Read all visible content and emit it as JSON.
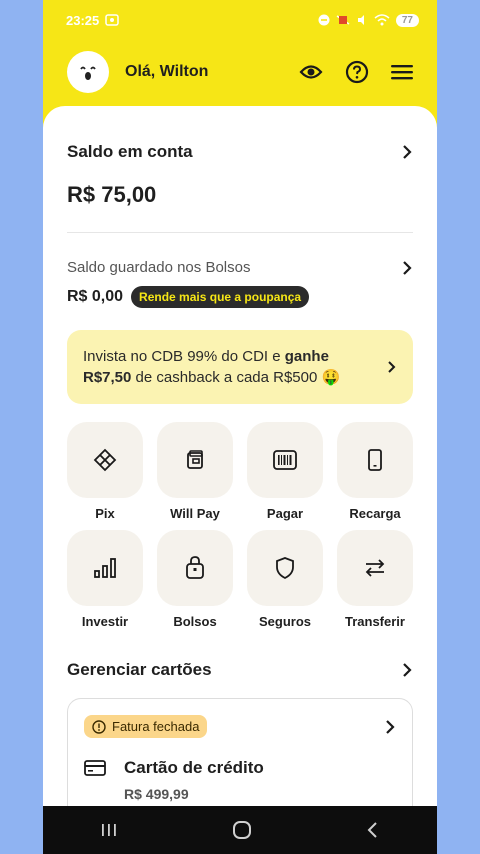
{
  "status": {
    "time": "23:25",
    "battery": "77"
  },
  "header": {
    "greeting": "Olá, Wilton"
  },
  "saldo": {
    "title": "Saldo em conta",
    "value": "R$ 75,00"
  },
  "bolsos": {
    "title": "Saldo guardado nos Bolsos",
    "value": "R$ 0,00",
    "badge": "Rende mais que a poupança"
  },
  "promo": {
    "text_1": "Invista no CDB 99% do CDI e ",
    "text_bold_1": "ganhe",
    "text_bold_2": "R$7,50",
    "text_2": " de cashback a cada R$500 🤑"
  },
  "shortcuts": [
    {
      "label": "Pix",
      "icon": "pix-icon"
    },
    {
      "label": "Will Pay",
      "icon": "wallet-icon"
    },
    {
      "label": "Pagar",
      "icon": "barcode-icon"
    },
    {
      "label": "Recarga",
      "icon": "phone-icon"
    },
    {
      "label": "Investir",
      "icon": "chart-icon"
    },
    {
      "label": "Bolsos",
      "icon": "pocket-icon"
    },
    {
      "label": "Seguros",
      "icon": "shield-icon"
    },
    {
      "label": "Transferir",
      "icon": "transfer-icon"
    }
  ],
  "cards": {
    "title": "Gerenciar cartões",
    "badge": "Fatura fechada",
    "card_title": "Cartão de crédito",
    "amount": "R$ 499,99"
  },
  "colors": {
    "brand_yellow": "#f6e616",
    "promo_bg": "#fbf3b2",
    "badge_orange": "#fbd68a"
  }
}
